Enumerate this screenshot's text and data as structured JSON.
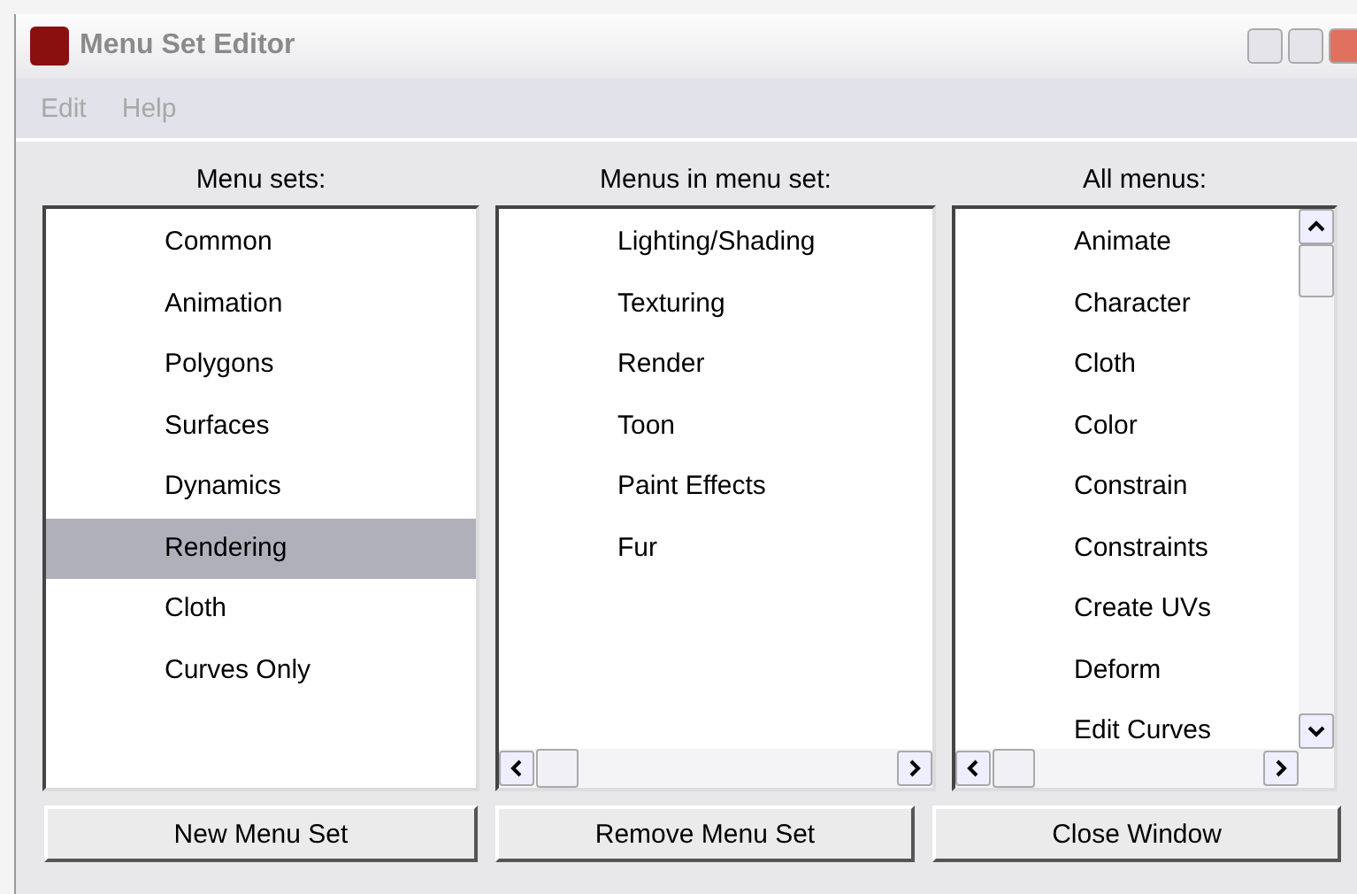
{
  "window": {
    "title": "Menu Set Editor"
  },
  "menu_bar": [
    "Edit",
    "Help"
  ],
  "lists": [
    {
      "header": "Menu sets:",
      "scroll_v": false,
      "scroll_h": false,
      "items": [
        {
          "label": "Common",
          "selected": false
        },
        {
          "label": "Animation",
          "selected": false
        },
        {
          "label": "Polygons",
          "selected": false
        },
        {
          "label": "Surfaces",
          "selected": false
        },
        {
          "label": "Dynamics",
          "selected": false
        },
        {
          "label": "Rendering",
          "selected": true
        },
        {
          "label": "Cloth",
          "selected": false
        },
        {
          "label": "Curves Only",
          "selected": false
        }
      ]
    },
    {
      "header": "Menus in menu set:",
      "scroll_v": false,
      "scroll_h": true,
      "items": [
        {
          "label": "Lighting/Shading",
          "selected": false
        },
        {
          "label": "Texturing",
          "selected": false
        },
        {
          "label": "Render",
          "selected": false
        },
        {
          "label": "Toon",
          "selected": false
        },
        {
          "label": "Paint Effects",
          "selected": false
        },
        {
          "label": "Fur",
          "selected": false
        }
      ]
    },
    {
      "header": "All menus:",
      "scroll_v": true,
      "scroll_h": true,
      "items": [
        {
          "label": "Animate",
          "selected": false
        },
        {
          "label": "Character",
          "selected": false
        },
        {
          "label": "Cloth",
          "selected": false
        },
        {
          "label": "Color",
          "selected": false
        },
        {
          "label": "Constrain",
          "selected": false
        },
        {
          "label": "Constraints",
          "selected": false
        },
        {
          "label": "Create UVs",
          "selected": false
        },
        {
          "label": "Deform",
          "selected": false
        },
        {
          "label": "Edit Curves",
          "selected": false
        }
      ]
    }
  ],
  "buttons": [
    "New Menu Set",
    "Remove Menu Set",
    "Close Window"
  ]
}
